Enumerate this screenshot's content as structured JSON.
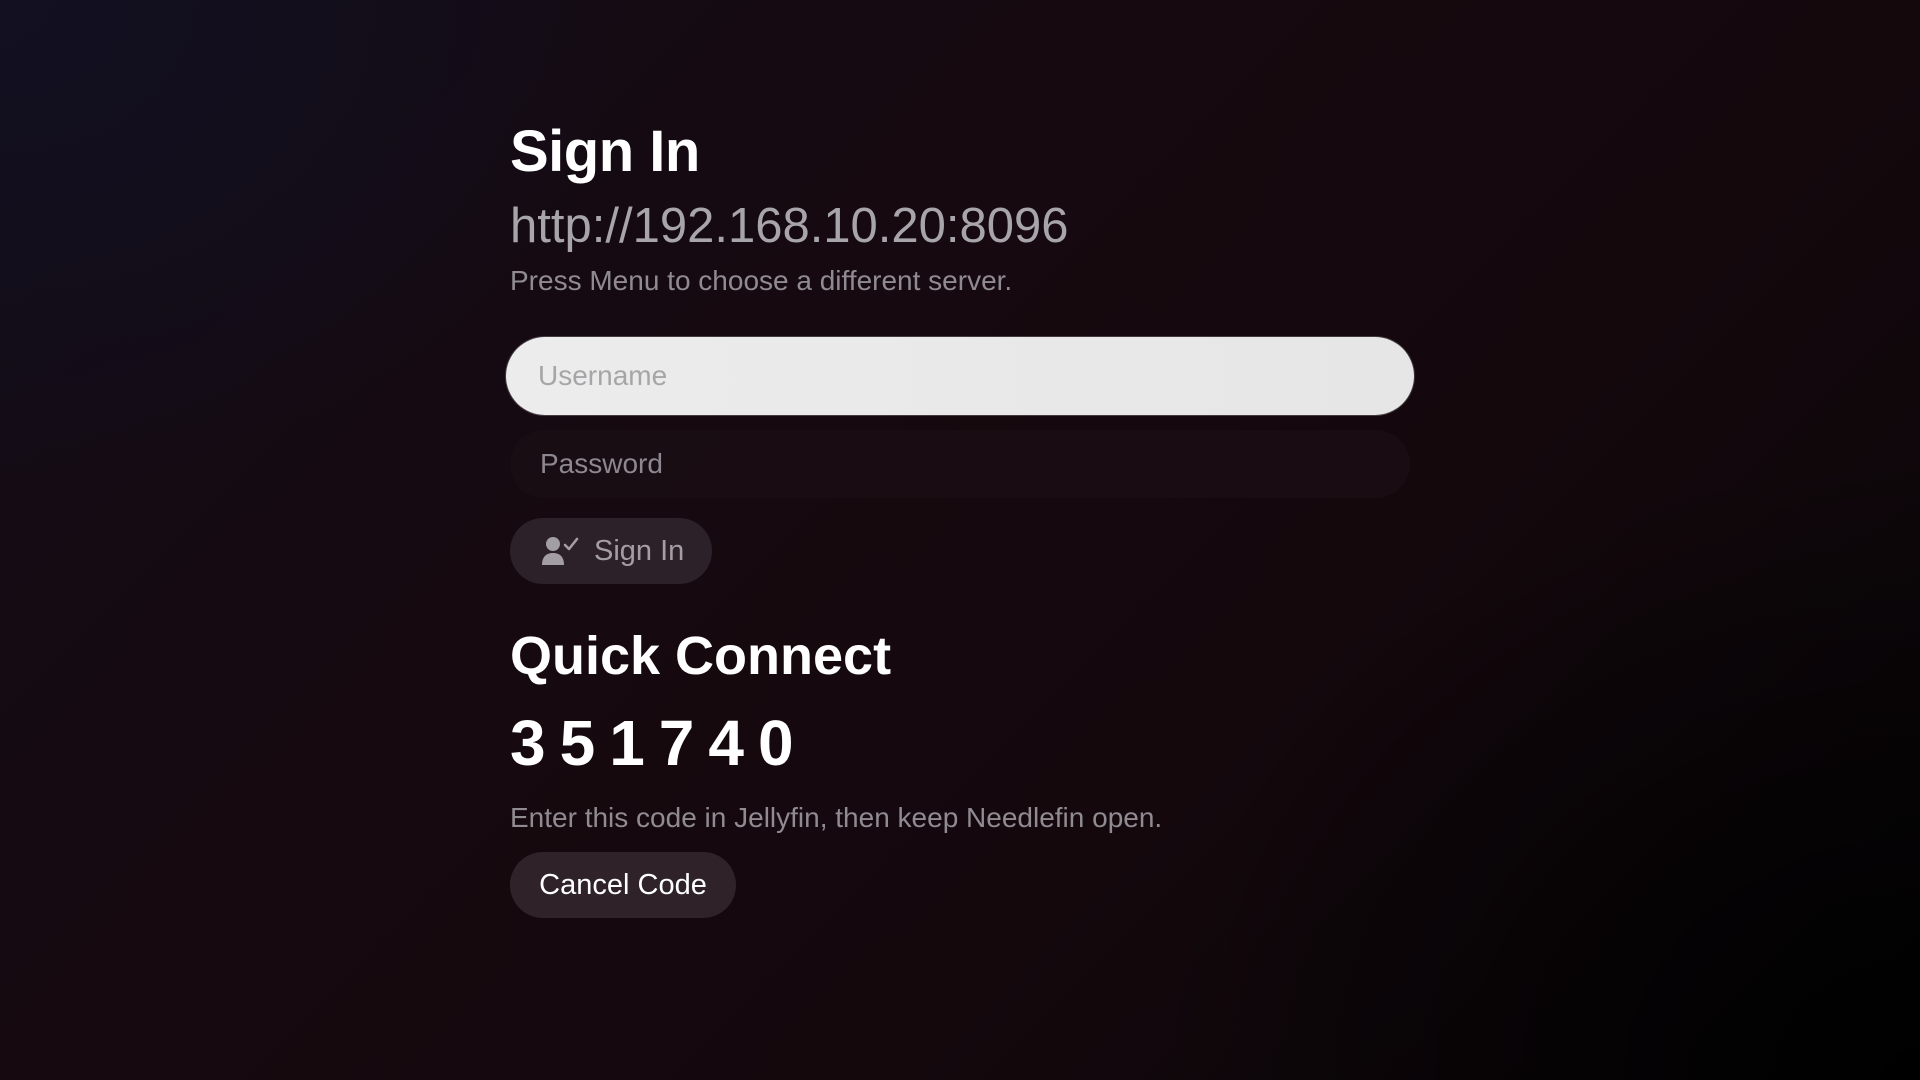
{
  "login": {
    "title": "Sign In",
    "server_url": "http://192.168.10.20:8096",
    "server_hint": "Press Menu to choose a different server.",
    "username_placeholder": "Username",
    "password_placeholder": "Password",
    "sign_in_label": "Sign In",
    "sign_in_icon": "person-check-icon"
  },
  "quick_connect": {
    "title": "Quick Connect",
    "code": "351740",
    "hint": "Enter this code in Jellyfin, then keep Needlefin open.",
    "cancel_label": "Cancel Code"
  },
  "colors": {
    "focused_field": "#ececec",
    "button_bg": "#2c2128",
    "muted_text": "#8f8b91"
  }
}
